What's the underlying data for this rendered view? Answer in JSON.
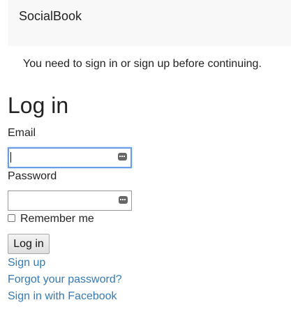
{
  "navbar": {
    "brand": "SocialBook"
  },
  "flash": {
    "notice": "You need to sign in or sign up before continuing."
  },
  "form": {
    "title": "Log in",
    "email_label": "Email",
    "email_value": "",
    "password_label": "Password",
    "password_value": "",
    "remember_label": "Remember me",
    "remember_checked": false,
    "submit_label": "Log in"
  },
  "links": {
    "sign_up": "Sign up",
    "forgot_password": "Forgot your password?",
    "facebook": "Sign in with Facebook"
  },
  "colors": {
    "link": "#337ab7",
    "navbar_bg": "#f8f8f8",
    "focus_border": "#6a9ce8"
  },
  "icons": {
    "field_icon": "password-manager-keyboard-icon"
  }
}
